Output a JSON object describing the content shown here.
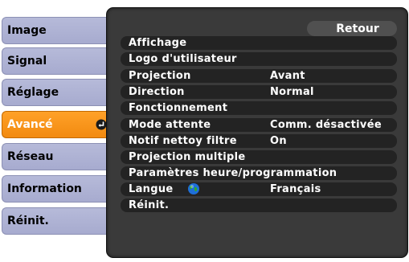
{
  "sidebar": {
    "items": [
      {
        "label": "Image"
      },
      {
        "label": "Signal"
      },
      {
        "label": "Réglage"
      },
      {
        "label": "Avancé"
      },
      {
        "label": "Réseau"
      },
      {
        "label": "Information"
      },
      {
        "label": "Réinit."
      }
    ],
    "active_index": 3
  },
  "menu": {
    "back_label": "Retour",
    "rows": [
      {
        "label": "Affichage",
        "value": ""
      },
      {
        "label": "Logo d'utilisateur",
        "value": ""
      },
      {
        "label": "Projection",
        "value": "Avant"
      },
      {
        "label": "Direction",
        "value": "Normal"
      },
      {
        "label": "Fonctionnement",
        "value": ""
      },
      {
        "label": "Mode attente",
        "value": "Comm. désactivée"
      },
      {
        "label": "Notif nettoy filtre",
        "value": "On"
      },
      {
        "label": "Projection multiple",
        "value": ""
      },
      {
        "label": "Paramètres heure/programmation",
        "value": ""
      },
      {
        "label": "Langue",
        "value": "Français",
        "icon": "globe-icon"
      },
      {
        "label": "Réinit.",
        "value": ""
      }
    ]
  },
  "colors": {
    "sidebar_bg": "#aeb2d4",
    "active_bg": "#f7941d",
    "panel_bg": "#3a3a3a",
    "row_bg": "#232323",
    "text": "#ffffff"
  }
}
